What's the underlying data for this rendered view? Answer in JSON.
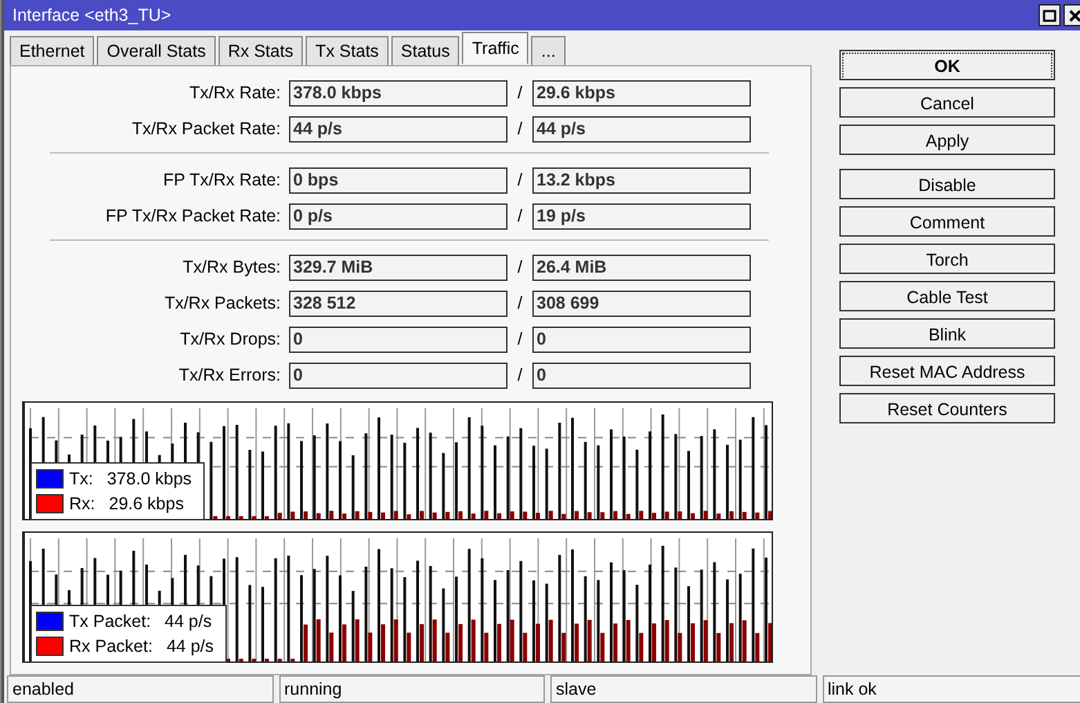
{
  "window": {
    "title": "Interface <eth3_TU>"
  },
  "tabs": [
    {
      "label": "Ethernet",
      "selected": false
    },
    {
      "label": "Overall Stats",
      "selected": false
    },
    {
      "label": "Rx Stats",
      "selected": false
    },
    {
      "label": "Tx Stats",
      "selected": false
    },
    {
      "label": "Status",
      "selected": false
    },
    {
      "label": "Traffic",
      "selected": true
    },
    {
      "label": "...",
      "selected": false
    }
  ],
  "stat_groups": [
    [
      {
        "label": "Tx/Rx Rate:",
        "tx": "378.0 kbps",
        "rx": "29.6 kbps"
      },
      {
        "label": "Tx/Rx Packet Rate:",
        "tx": "44 p/s",
        "rx": "44 p/s"
      }
    ],
    [
      {
        "label": "FP Tx/Rx Rate:",
        "tx": "0 bps",
        "rx": "13.2 kbps"
      },
      {
        "label": "FP Tx/Rx Packet Rate:",
        "tx": "0 p/s",
        "rx": "19 p/s"
      }
    ],
    [
      {
        "label": "Tx/Rx Bytes:",
        "tx": "329.7 MiB",
        "rx": "26.4 MiB"
      },
      {
        "label": "Tx/Rx Packets:",
        "tx": "328 512",
        "rx": "308 699"
      },
      {
        "label": "Tx/Rx Drops:",
        "tx": "0",
        "rx": "0"
      },
      {
        "label": "Tx/Rx Errors:",
        "tx": "0",
        "rx": "0"
      }
    ]
  ],
  "separator": "/",
  "graphs": [
    {
      "legend": [
        {
          "label": "Tx:",
          "value": "378.0 kbps",
          "color": "#0000ff"
        },
        {
          "label": "Rx:",
          "value": "29.6 kbps",
          "color": "#ff0000"
        }
      ]
    },
    {
      "legend": [
        {
          "label": "Tx Packet:",
          "value": "44 p/s",
          "color": "#0000ff"
        },
        {
          "label": "Rx Packet:",
          "value": "44 p/s",
          "color": "#ff0000"
        }
      ]
    }
  ],
  "dialog_buttons": [
    {
      "label": "OK",
      "focused": true
    },
    {
      "label": "Cancel",
      "focused": false
    },
    {
      "label": "Apply",
      "focused": false
    }
  ],
  "action_buttons": [
    {
      "label": "Disable",
      "focused": false
    },
    {
      "label": "Comment",
      "focused": false
    },
    {
      "label": "Torch",
      "focused": false
    },
    {
      "label": "Cable Test",
      "focused": false
    },
    {
      "label": "Blink",
      "focused": false
    },
    {
      "label": "Reset MAC Address",
      "focused": false
    },
    {
      "label": "Reset Counters",
      "focused": false
    }
  ],
  "status_bar": [
    "enabled",
    "running",
    "slave",
    "link ok"
  ]
}
